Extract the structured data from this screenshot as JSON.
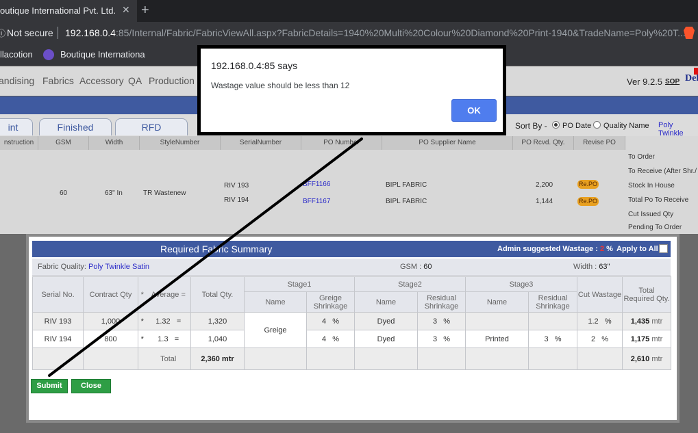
{
  "browser": {
    "tab_title": "outique International Pvt. Ltd.",
    "tab_close": "✕",
    "new_tab": "+",
    "lock": "ⓘ",
    "security": "Not secure",
    "url_host": "192.168.0.4",
    "url_rest": ":85/Internal/Fabric/FabricViewAll.aspx?FabricDetails=1940%20Multi%20Colour%20Diamond%20Print-1940&TradeName=Poly%20T...",
    "bookmarks": [
      "llacotion",
      "Boutique Internationa"
    ]
  },
  "app_menu": {
    "items": [
      "andising",
      "Fabrics",
      "Accessory",
      "QA",
      "Production"
    ],
    "version": "Ver 9.2.5",
    "sop": "SOP",
    "logo": "Del"
  },
  "page_tabs": [
    "int",
    "Finished",
    "RFD"
  ],
  "sort": {
    "label": "Sort By -",
    "options": [
      "PO Date",
      "Quality Name"
    ],
    "selected": "PO Date",
    "quality": "Poly Twinkle"
  },
  "grid": {
    "headers": [
      "nstruction",
      "GSM",
      "Width",
      "StyleNumber",
      "SerialNumber",
      "PO Number",
      "PO Supplier Name",
      "PO Rcvd. Qty.",
      "Revise PO"
    ],
    "gsm": "60",
    "width": "63\" In",
    "style": "TR Wastenew",
    "rows": [
      {
        "serial": "RIV 193",
        "po": "BFF1166",
        "supplier": "BIPL FABRIC",
        "qty": "2,200",
        "revise": "Re.PO"
      },
      {
        "serial": "RIV 194",
        "po": "BFF1167",
        "supplier": "BIPL FABRIC",
        "qty": "1,144",
        "revise": "Re.PO"
      }
    ],
    "side": [
      "To Order",
      "To Receive (After Shr./",
      "Stock In House",
      "Total Po To Receive",
      "Cut Issued Qty",
      "Pending To Order"
    ]
  },
  "modal": {
    "title": "Required Fabric Summary",
    "admin_label": "Admin suggested Wastage :",
    "admin_value": "2",
    "admin_unit": "%",
    "apply_all": "Apply to All",
    "quality_label": "Fabric Quality:",
    "quality_value": "Poly Twinkle Satin",
    "gsm_label": "GSM :",
    "gsm_value": "60",
    "width_label": "Width :",
    "width_value": "63\"",
    "headers": {
      "serial": "Serial No.",
      "contract": "Contract Qty",
      "star": "*",
      "average": "Average =",
      "total": "Total Qty.",
      "stage1": "Stage1",
      "stage2": "Stage2",
      "stage3": "Stage3",
      "cut": "Cut Wastage",
      "req": "Total Required Qty.",
      "name": "Name",
      "greige_shr": "Greige Shrinkage",
      "residual_shr": "Residual Shrinkage"
    },
    "rows": [
      {
        "serial": "RIV 193",
        "contract": "1,000",
        "star": "*",
        "avg": "1.32",
        "eq": "=",
        "total": "1,320",
        "s1_shr": "4",
        "s2_name": "Dyed",
        "s2_shr": "3",
        "s3_name": "",
        "s3_shr": "",
        "cut": "1.2",
        "req": "1,435",
        "unit": "mtr",
        "pct": "%"
      },
      {
        "serial": "RIV 194",
        "contract": "800",
        "star": "*",
        "avg": "1.3",
        "eq": "=",
        "total": "1,040",
        "s1_shr": "4",
        "s2_name": "Dyed",
        "s2_shr": "3",
        "s3_name": "Printed",
        "s3_shr": "3",
        "cut": "2",
        "req": "1,175",
        "unit": "mtr",
        "pct": "%"
      }
    ],
    "greige_name": "Greige",
    "total_label": "Total",
    "total_qty": "2,360",
    "total_unit": "mtr",
    "total_req": "2,610",
    "submit": "Submit",
    "close": "Close"
  },
  "alert": {
    "title": "192.168.0.4:85 says",
    "message": "Wastage value should be less than 12",
    "ok": "OK"
  }
}
